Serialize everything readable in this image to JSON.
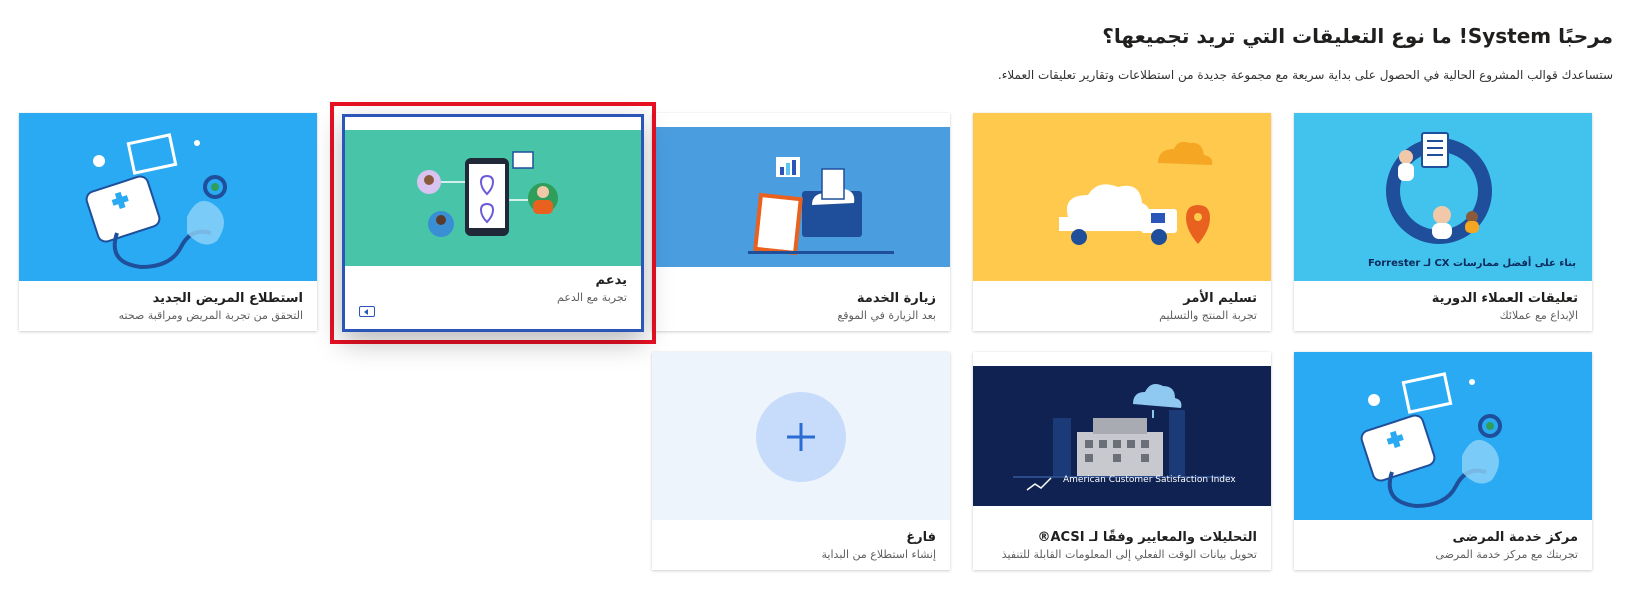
{
  "header": {
    "title": "مرحبًا System! ما نوع التعليقات التي تريد تجميعها؟",
    "subtitle": "ستساعدك قوالب المشروع الحالية في الحصول على بداية سريعة مع مجموعة جديدة من استطلاعات وتقارير تعليقات العملاء."
  },
  "templates": [
    {
      "name": "تعليقات العملاء الدورية",
      "desc": "الإبداع مع عملائك",
      "banner": "بناء على أفضل ممارسات CX لـ Forrester",
      "color": "#42c3ee"
    },
    {
      "name": "تسليم الأمر",
      "desc": "تجربة المنتج والتسليم",
      "color": "#ffc94d"
    },
    {
      "name": "زيارة الخدمة",
      "desc": "بعد الزيارة في الموقع",
      "color": "#4a9ee0"
    },
    {
      "name": "يدعم",
      "desc": "تجربة مع الدعم",
      "color": "#48c4a8",
      "selected": true
    },
    {
      "name": "استطلاع المريض الجديد",
      "desc": "التحقق من تجربة المريض ومراقبة صحته",
      "color": "#29aaf2"
    },
    {
      "name": "مركز خدمة المرضى",
      "desc": "تجربتك مع مركز خدمة المرضى",
      "color": "#29aaf2"
    },
    {
      "name": "التحليلات والمعايير وفقًا لـ ACSI®",
      "desc": "تحويل بيانات الوقت الفعلي إلى المعلومات القابلة للتنفيذ",
      "banner": "American Customer Satisfaction Index",
      "color": "#0f2251"
    },
    {
      "name": "فارغ",
      "desc": "إنشاء استطلاع من البداية",
      "color": "#eef4fc"
    }
  ]
}
